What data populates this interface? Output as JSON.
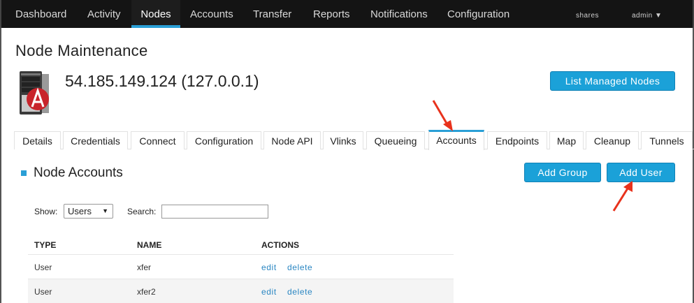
{
  "topnav": {
    "items": [
      {
        "label": "Dashboard"
      },
      {
        "label": "Activity"
      },
      {
        "label": "Nodes"
      },
      {
        "label": "Accounts"
      },
      {
        "label": "Transfer"
      },
      {
        "label": "Reports"
      },
      {
        "label": "Notifications"
      },
      {
        "label": "Configuration"
      }
    ],
    "active": "Nodes",
    "shares": "shares",
    "user": "admin ▼"
  },
  "page": {
    "title": "Node Maintenance",
    "node": "54.185.149.124 (127.0.0.1)",
    "list_button": "List Managed Nodes"
  },
  "tabs": [
    {
      "label": "Details"
    },
    {
      "label": "Credentials"
    },
    {
      "label": "Connect"
    },
    {
      "label": "Configuration"
    },
    {
      "label": "Node API"
    },
    {
      "label": "Vlinks"
    },
    {
      "label": "Queueing"
    },
    {
      "label": "Accounts"
    },
    {
      "label": "Endpoints"
    },
    {
      "label": "Map"
    },
    {
      "label": "Cleanup"
    },
    {
      "label": "Tunnels"
    }
  ],
  "active_tab": "Accounts",
  "section": {
    "title": "Node Accounts",
    "add_group": "Add Group",
    "add_user": "Add User"
  },
  "filters": {
    "show_label": "Show:",
    "show_value": "Users",
    "search_label": "Search:",
    "search_value": ""
  },
  "table": {
    "headers": [
      "TYPE",
      "NAME",
      "ACTIONS"
    ],
    "rows": [
      {
        "type": "User",
        "name": "xfer",
        "edit": "edit",
        "delete": "delete"
      },
      {
        "type": "User",
        "name": "xfer2",
        "edit": "edit",
        "delete": "delete"
      }
    ]
  },
  "colors": {
    "accent": "#2a9fd6",
    "button": "#1ba1d8",
    "annotation_arrow": "#e8321c",
    "nav_bg": "#141414"
  }
}
